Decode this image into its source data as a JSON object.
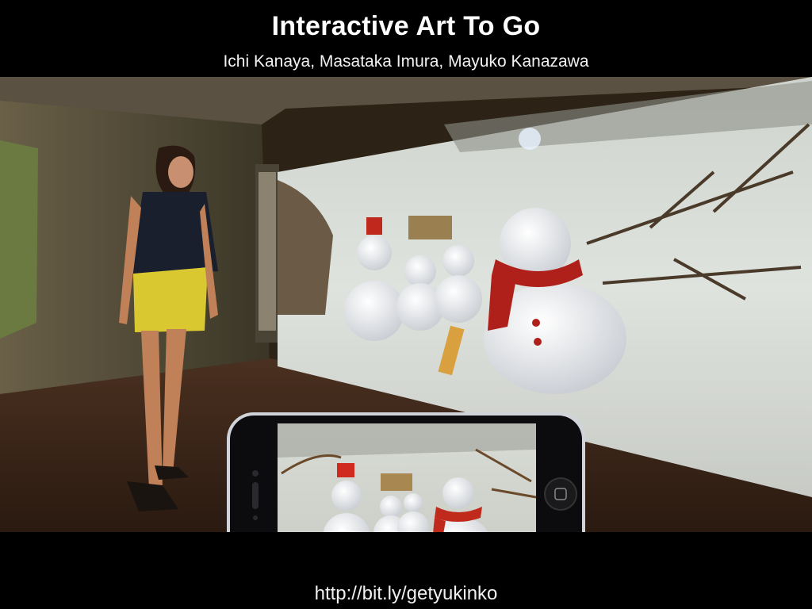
{
  "slide": {
    "title": "Interactive Art To Go",
    "authors": "Ichi Kanaya, Masataka Imura, Mayuko Kanazawa",
    "url": "http://bit.ly/getyukinko"
  },
  "colors": {
    "background": "#000000",
    "title_text": "#ffffff",
    "scarf_red": "#b0201a",
    "shorts_yellow": "#d9c830"
  }
}
